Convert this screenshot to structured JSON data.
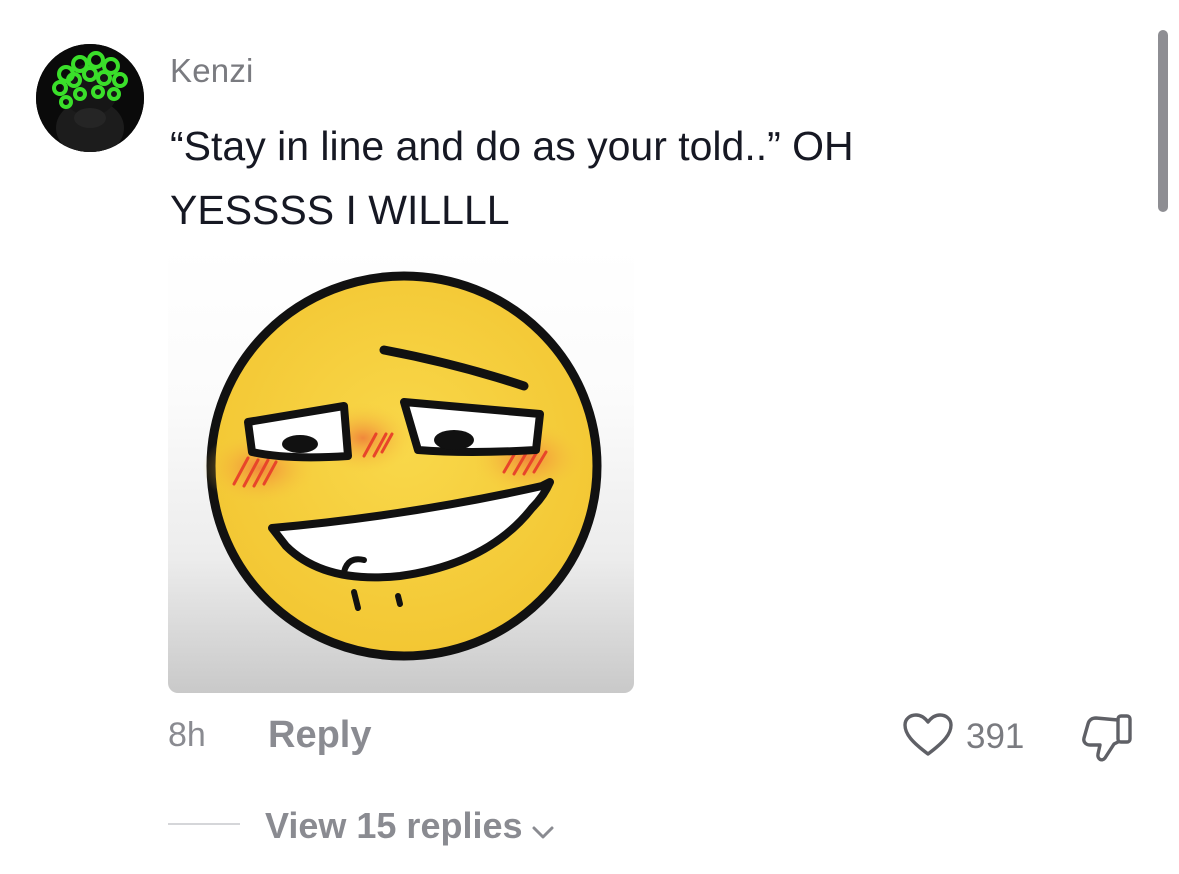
{
  "comment": {
    "username": "Kenzi",
    "text_line1": "“Stay in line and do as your told..” OH",
    "text_line2": "YESSSS I WILLLL",
    "time": "8h",
    "reply_label": "Reply",
    "like_count": "391",
    "view_replies_label": "View 15 replies"
  },
  "icons": {
    "like": "heart-outline-icon",
    "dislike": "thumbs-down-icon",
    "expand": "chevron-down-icon"
  },
  "colors": {
    "text_primary": "#161823",
    "text_secondary": "#8a8b91",
    "avatar_accent": "#35d12a",
    "sticker_face": "#f6cf3c",
    "blush": "#f08a3a"
  }
}
